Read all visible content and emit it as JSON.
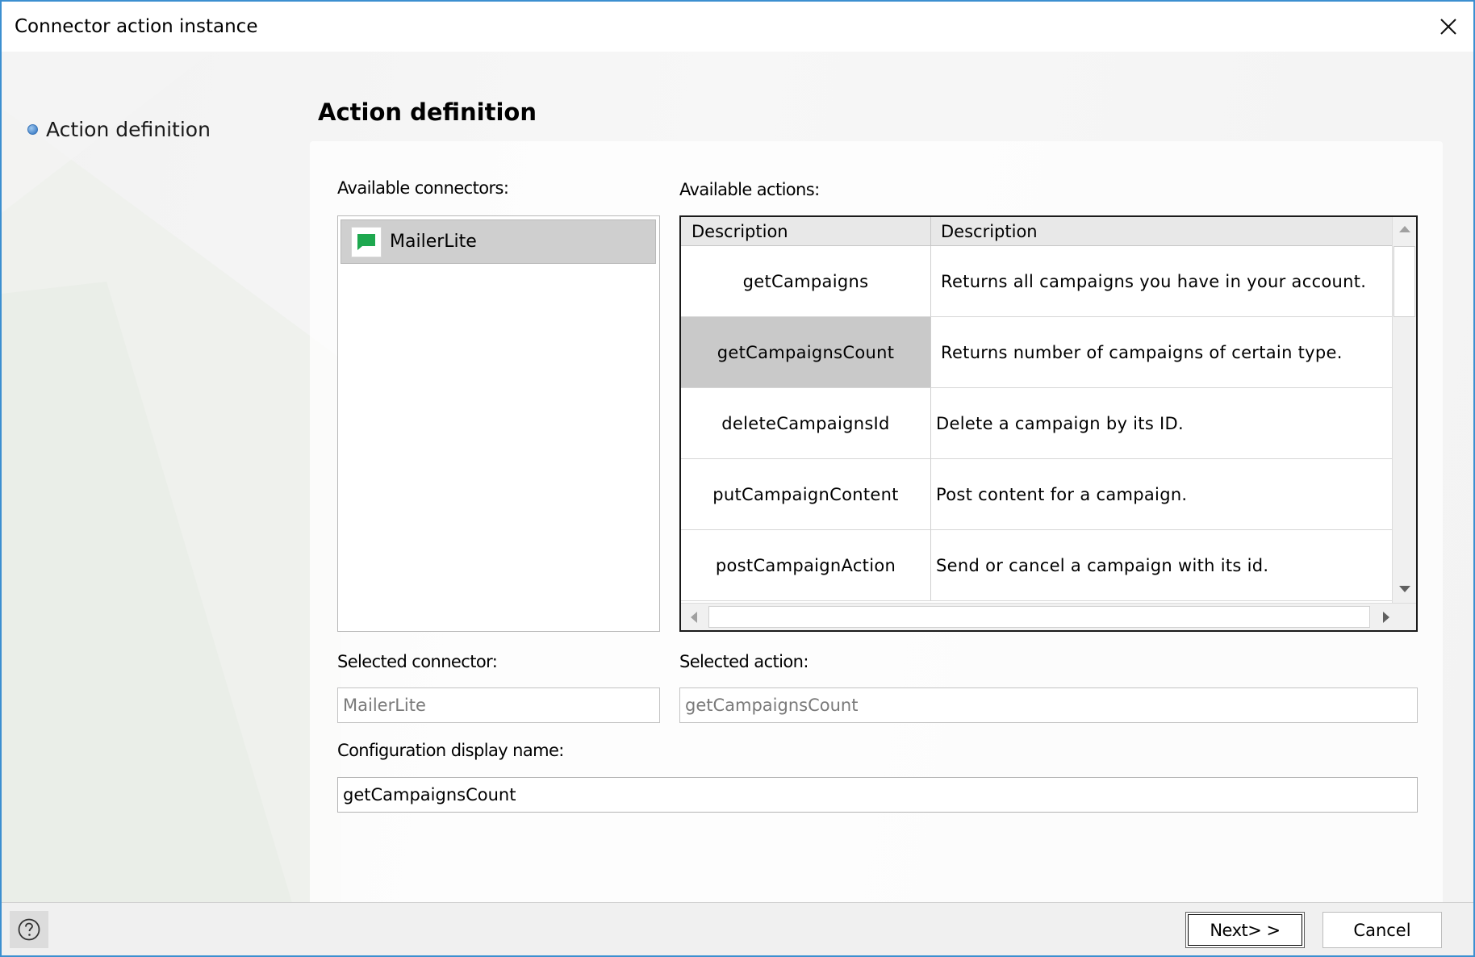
{
  "window": {
    "title": "Connector action instance",
    "accent_color": "#3c8fd0"
  },
  "nav": {
    "items": [
      {
        "label": "Action definition",
        "active": true
      }
    ]
  },
  "section": {
    "title": "Action definition"
  },
  "connectors": {
    "label": "Available connectors:",
    "items": [
      {
        "name": "MailerLite",
        "icon": "chat-bubble-icon",
        "icon_color": "#1ea84f",
        "selected": true
      }
    ]
  },
  "actions": {
    "label": "Available actions:",
    "columns": [
      "Description",
      "Description"
    ],
    "rows": [
      {
        "name": "getCampaigns",
        "description": "Returns all campaigns you have in your account.",
        "selected": false
      },
      {
        "name": "getCampaignsCount",
        "description": "Returns number of campaigns of certain type.",
        "selected": true
      },
      {
        "name": "deleteCampaignsId",
        "description": "Delete a campaign by its ID.",
        "selected": false
      },
      {
        "name": "putCampaignContent",
        "description": "Post content for a campaign.",
        "selected": false
      },
      {
        "name": "postCampaignAction",
        "description": "Send or cancel a campaign with its id.",
        "selected": false
      }
    ]
  },
  "selected_connector": {
    "label": "Selected connector:",
    "value": "MailerLite"
  },
  "selected_action": {
    "label": "Selected action:",
    "value": "getCampaignsCount"
  },
  "display_name": {
    "label": "Configuration display name:",
    "value": "getCampaignsCount"
  },
  "footer": {
    "help_icon": "question-circle-icon",
    "next_label": "Next> >",
    "cancel_label": "Cancel"
  }
}
